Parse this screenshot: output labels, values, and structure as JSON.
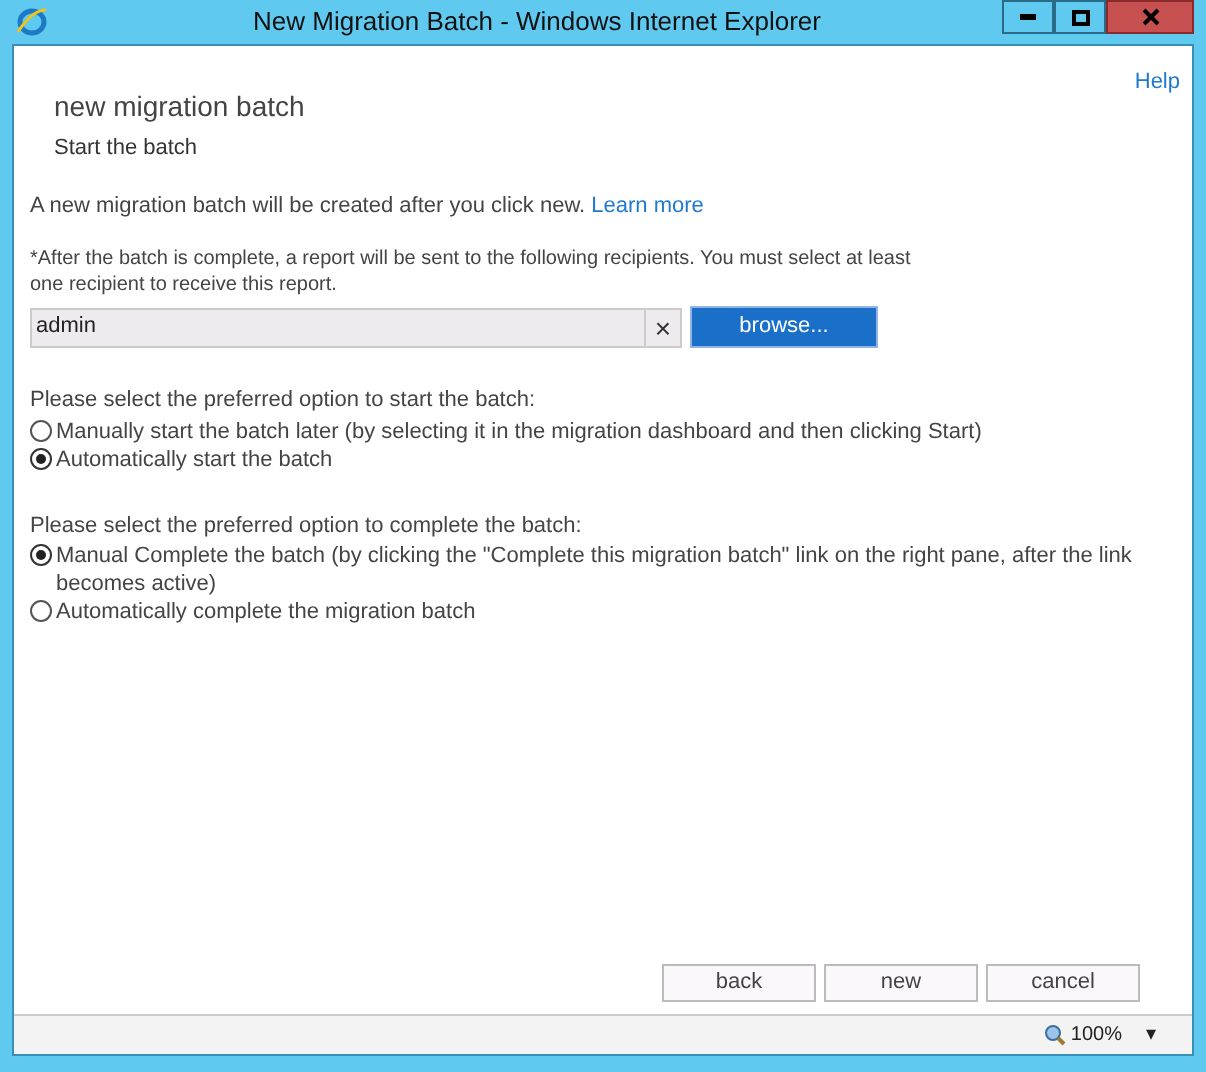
{
  "window": {
    "title": "New Migration Batch - Windows Internet Explorer"
  },
  "help": "Help",
  "heading": "new migration batch",
  "subheading": "Start the batch",
  "intro": {
    "text": "A new migration batch will be created after you click new.",
    "link": "Learn more"
  },
  "recipients": {
    "note": "*After the batch is complete, a report will be sent to the following recipients. You must select at least one recipient to receive this report.",
    "value": "admin",
    "clear": "×",
    "browse": "browse..."
  },
  "start_options": {
    "prompt": "Please select the preferred option to start the batch:",
    "options": [
      {
        "label": "Manually start the batch later (by selecting it in the migration dashboard and then clicking Start)",
        "selected": false
      },
      {
        "label": "Automatically start the batch",
        "selected": true
      }
    ]
  },
  "complete_options": {
    "prompt": "Please select the preferred option to complete the batch:",
    "options": [
      {
        "label": "Manual Complete the batch (by clicking the \"Complete this migration batch\" link on the right pane, after the link becomes active)",
        "selected": true
      },
      {
        "label": "Automatically complete the migration batch",
        "selected": false
      }
    ]
  },
  "buttons": [
    "back",
    "new",
    "cancel"
  ],
  "status_bar": {
    "zoom": "100%",
    "dropdown": "▾"
  }
}
